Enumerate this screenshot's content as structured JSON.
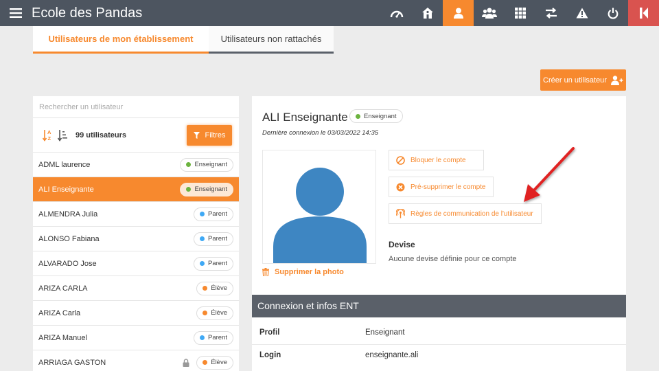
{
  "app": {
    "title": "Ecole des Pandas"
  },
  "topnav": [
    {
      "icon": "dashboard-icon"
    },
    {
      "icon": "school-icon"
    },
    {
      "icon": "user-icon",
      "active": true
    },
    {
      "icon": "users-icon"
    },
    {
      "icon": "apps-grid-icon"
    },
    {
      "icon": "transfer-icon"
    },
    {
      "icon": "warning-icon"
    },
    {
      "icon": "power-icon"
    },
    {
      "icon": "exit-icon"
    }
  ],
  "tabs": [
    "Utilisateurs de mon établissement",
    "Utilisateurs non rattachés"
  ],
  "create_button": "Créer un utilisateur",
  "search": {
    "placeholder": "Rechercher un utilisateur"
  },
  "count_label": "99 utilisateurs",
  "filter_label": "Filtres",
  "users": [
    {
      "name": "ADML laurence",
      "role": "Enseignant",
      "color": "#6cb33f"
    },
    {
      "name": "ALI Enseignante",
      "role": "Enseignant",
      "color": "#6cb33f",
      "selected": true
    },
    {
      "name": "ALMENDRA Julia",
      "role": "Parent",
      "color": "#3fa9f5"
    },
    {
      "name": "ALONSO Fabiana",
      "role": "Parent",
      "color": "#3fa9f5"
    },
    {
      "name": "ALVARADO Jose",
      "role": "Parent",
      "color": "#3fa9f5"
    },
    {
      "name": "ARIZA CARLA",
      "role": "Élève",
      "color": "#f7892e"
    },
    {
      "name": "ARIZA Carla",
      "role": "Élève",
      "color": "#f7892e"
    },
    {
      "name": "ARIZA Manuel",
      "role": "Parent",
      "color": "#3fa9f5"
    },
    {
      "name": "ARRIAGA GASTON",
      "role": "Élève",
      "color": "#f7892e",
      "locked": true
    }
  ],
  "detail": {
    "name": "ALI Enseignante",
    "role": "Enseignant",
    "last_login": "Dernière connexion le 03/03/2022 14:35",
    "delete_photo": "Supprimer la photo",
    "actions": {
      "block": "Bloquer le compte",
      "pre_delete": "Pré-supprimer le compte",
      "rules": "Règles de communication de l'utilisateur"
    },
    "devise_title": "Devise",
    "devise_text": "Aucune devise définie pour ce compte",
    "section_title": "Connexion et infos ENT",
    "info": [
      {
        "label": "Profil",
        "value": "Enseignant"
      },
      {
        "label": "Login",
        "value": "enseignante.ali"
      }
    ]
  },
  "colors": {
    "accent": "#f7892e",
    "topbar": "#4d5560",
    "teacher": "#6cb33f",
    "parent": "#3fa9f5",
    "student": "#f7892e",
    "arrow": "#e02020"
  }
}
